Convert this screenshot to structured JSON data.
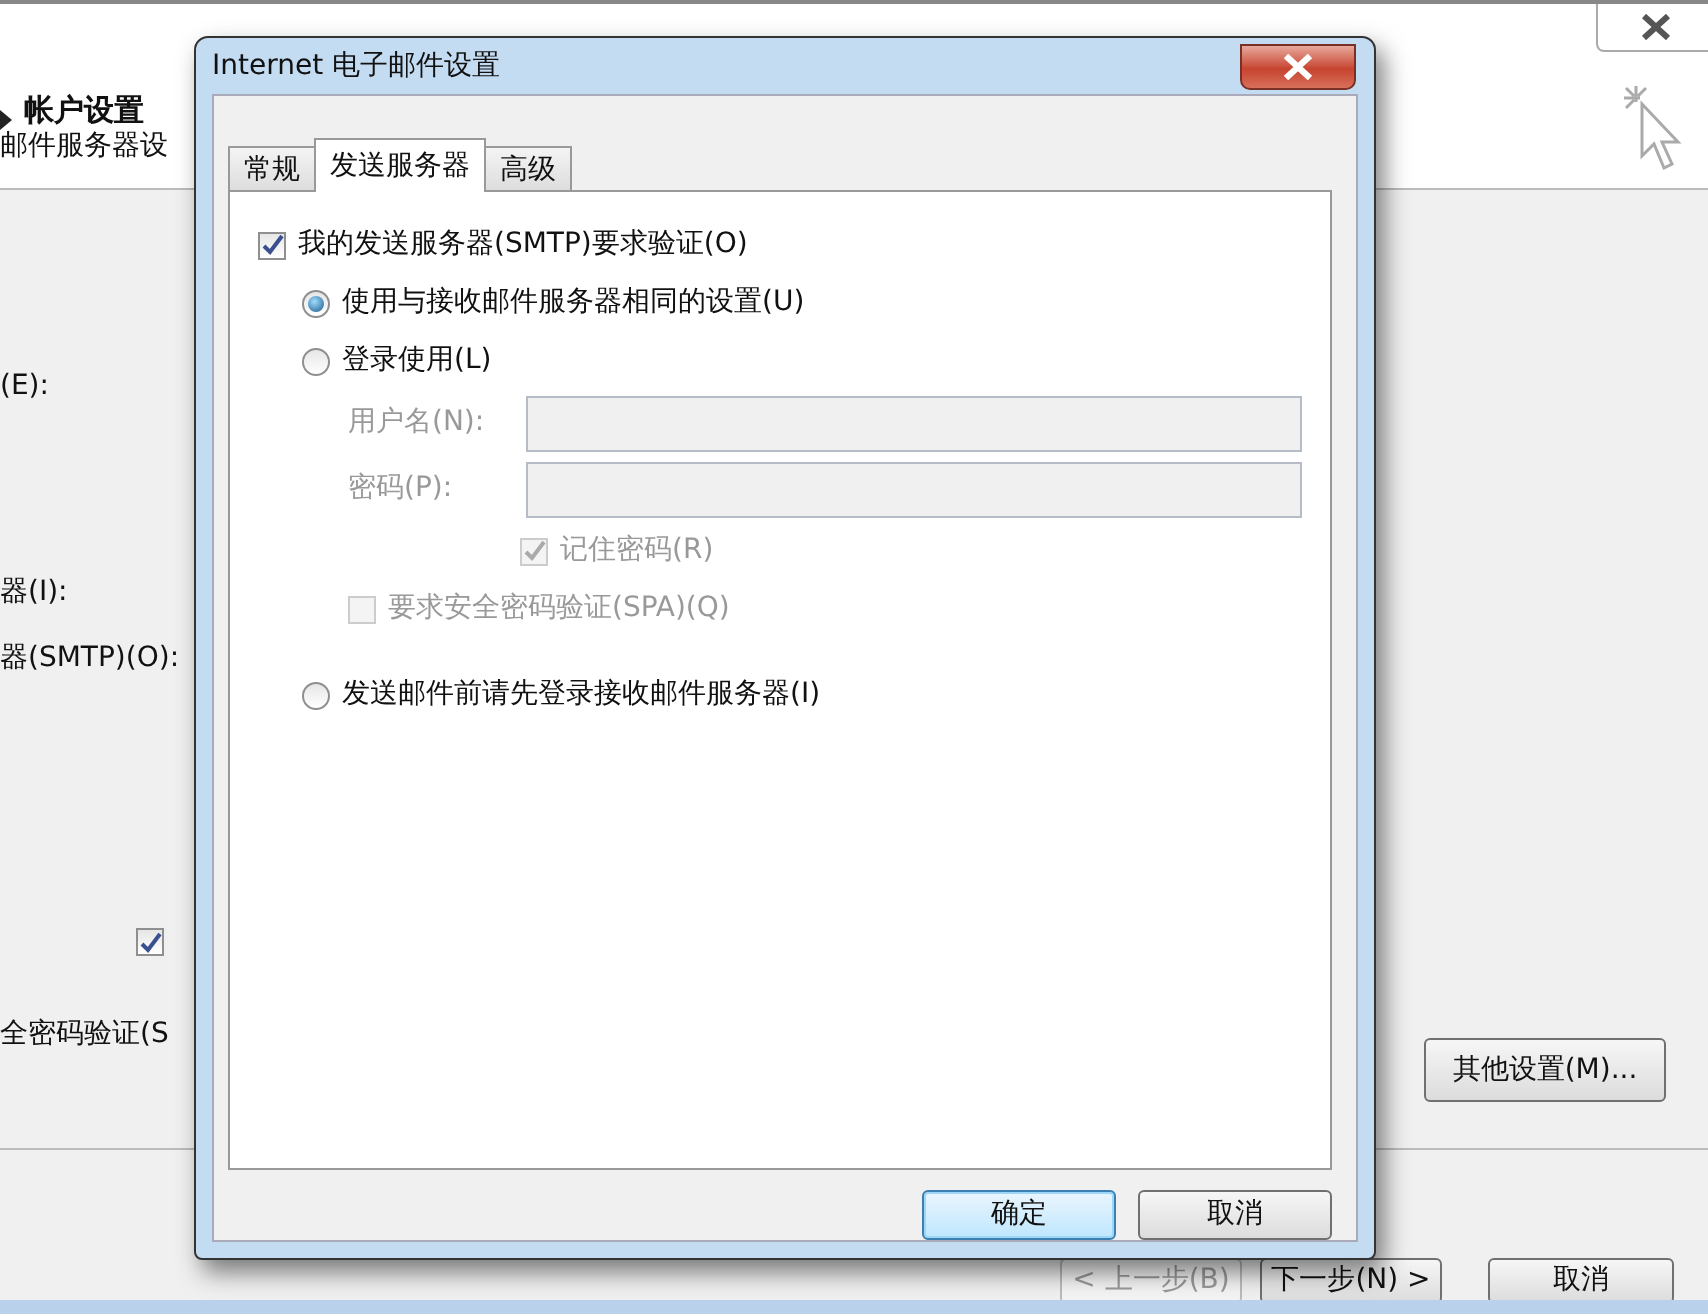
{
  "background_window": {
    "header": "帐户设置",
    "subheader": "邮件服务器设",
    "labels": [
      "(E):",
      "器(I):",
      "器(SMTP)(O):"
    ],
    "remember_checkbox": {
      "checked": true
    },
    "spa_label": "全密码验证(S",
    "more_settings_button": "其他设置(M)...",
    "nav_buttons": [
      {
        "label": "< 上一步(B)",
        "disabled": true
      },
      {
        "label": "下一步(N) >",
        "disabled": false
      },
      {
        "label": "取消",
        "disabled": false
      }
    ]
  },
  "dialog": {
    "title": "Internet 电子邮件设置",
    "tabs": [
      {
        "label": "常规",
        "selected": false
      },
      {
        "label": "发送服务器",
        "selected": true
      },
      {
        "label": "高级",
        "selected": false
      }
    ],
    "smtp_auth": {
      "label": "我的发送服务器(SMTP)要求验证(O)",
      "checked": true
    },
    "radios": [
      {
        "label": "使用与接收邮件服务器相同的设置(U)",
        "selected": true
      },
      {
        "label": "登录使用(L)",
        "selected": false
      },
      {
        "label": "发送邮件前请先登录接收邮件服务器(I)",
        "selected": false
      }
    ],
    "login_fields": [
      {
        "label": "用户名(N):",
        "disabled": true
      },
      {
        "label": "密码(P):",
        "disabled": true
      }
    ],
    "remember_password": {
      "label": "记住密码(R)",
      "checked": true,
      "disabled": true
    },
    "spa": {
      "label": "要求安全密码验证(SPA)(Q)",
      "checked": false,
      "disabled": true
    },
    "buttons": [
      {
        "label": "确定",
        "default": true
      },
      {
        "label": "取消",
        "default": false
      }
    ]
  }
}
